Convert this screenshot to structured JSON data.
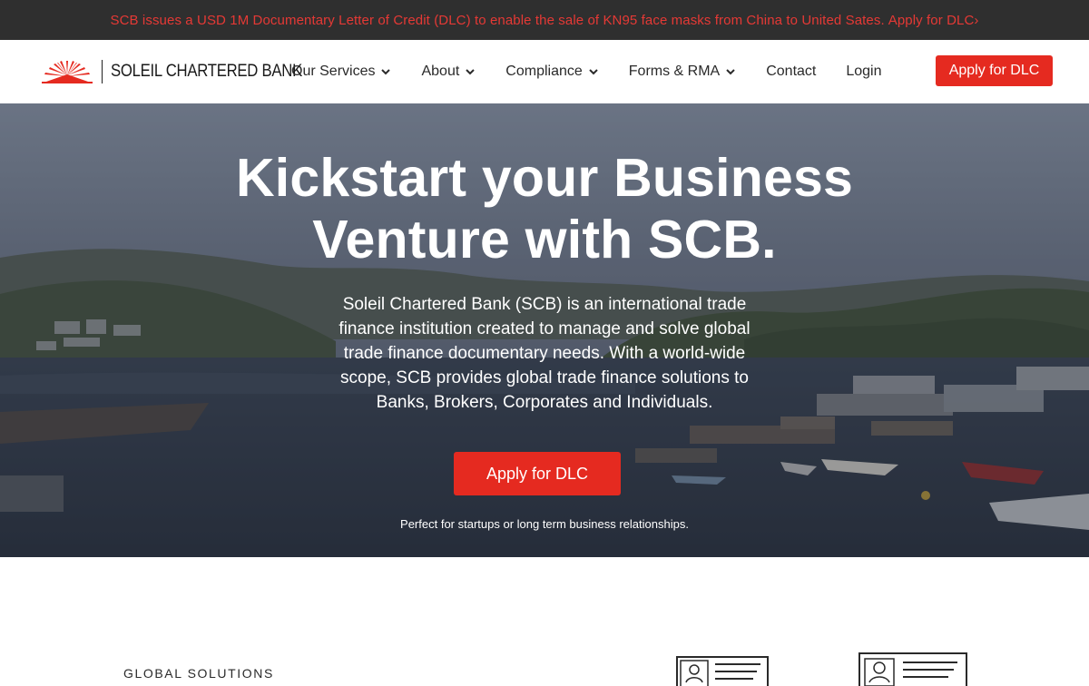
{
  "announcement": {
    "message": "SCB issues a USD 1M Documentary Letter of Credit (DLC) to enable the sale of KN95 face masks from China to United Sates.",
    "link_label": "Apply for DLC›"
  },
  "brand": {
    "name": "SOLEIL CHARTERED BANK",
    "logo_icon": "sunburst-logo-icon",
    "accent_color": "#e52a20"
  },
  "nav": {
    "items": [
      {
        "label": "Our Services",
        "has_dropdown": true
      },
      {
        "label": "About",
        "has_dropdown": true
      },
      {
        "label": "Compliance",
        "has_dropdown": true
      },
      {
        "label": "Forms & RMA",
        "has_dropdown": true
      },
      {
        "label": "Contact",
        "has_dropdown": false
      },
      {
        "label": "Login",
        "has_dropdown": false
      }
    ],
    "cta_label": "Apply for DLC"
  },
  "hero": {
    "title_line1": "Kickstart your Business",
    "title_line2": "Venture with SCB.",
    "description": "Soleil Chartered Bank (SCB) is an international trade finance institution created to manage and solve global trade finance documentary needs. With a world-wide scope, SCB provides global trade finance solutions to Banks, Brokers, Corporates and Individuals.",
    "cta_label": "Apply for DLC",
    "note": "Perfect for startups or long term business relationships."
  },
  "section": {
    "label": "GLOBAL SOLUTIONS"
  }
}
